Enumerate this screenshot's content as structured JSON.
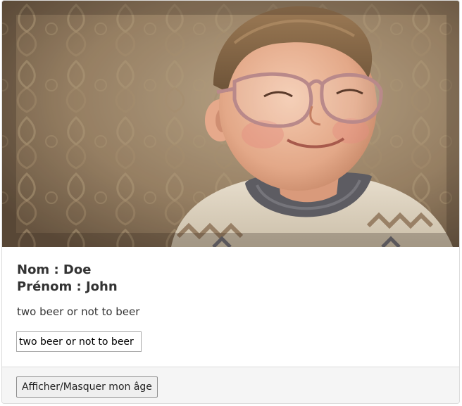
{
  "card": {
    "photo": {
      "icon": "portrait-photo-boy-with-large-glasses"
    },
    "nom_line": "Nom : Doe",
    "prenom_line": "Prénom : John",
    "quote_text": "two beer or not to beer",
    "quote_input_value": "two beer or not to beer",
    "toggle_age_button": "Afficher/Masquer mon âge"
  },
  "colors": {
    "card_border": "#dcdcdc",
    "footer_bg": "#f5f5f5",
    "text": "#333333"
  }
}
